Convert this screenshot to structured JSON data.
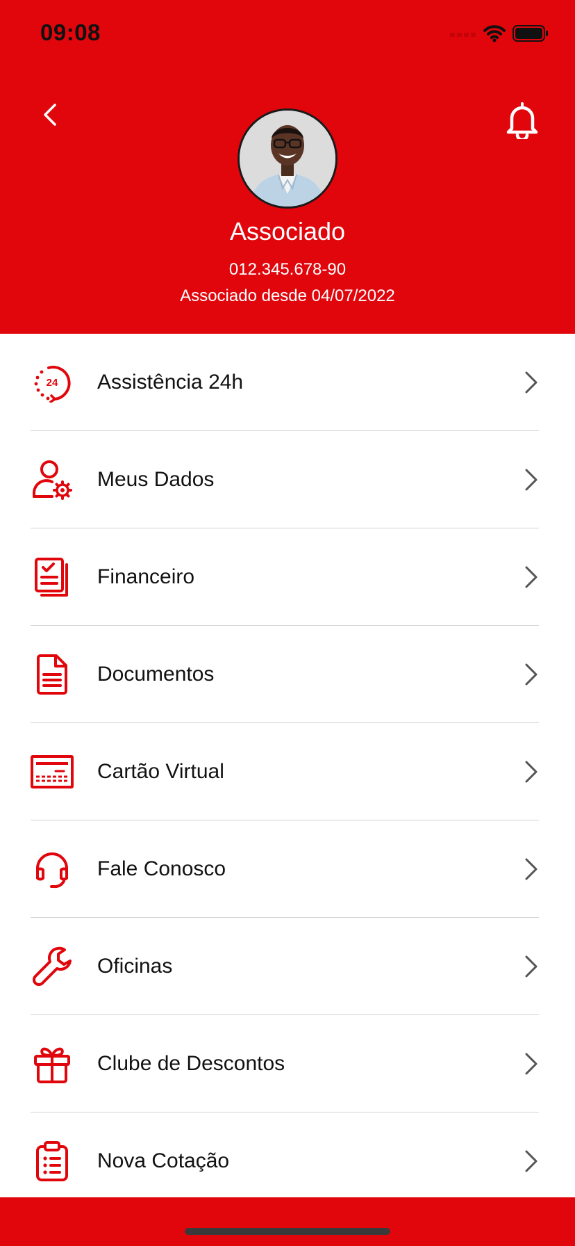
{
  "status_bar": {
    "time": "09:08",
    "icons": [
      "signal-icon",
      "wifi-icon",
      "battery-icon"
    ]
  },
  "header": {
    "back_icon": "chevron-left-icon",
    "notification_icon": "bell-icon",
    "avatar_icon": "avatar",
    "name": "Associado",
    "document": "012.345.678-90",
    "member_since": "Associado desde 04/07/2022"
  },
  "menu": {
    "items": [
      {
        "label": "Assistência 24h",
        "icon": "assistance-24h-icon"
      },
      {
        "label": "Meus Dados",
        "icon": "user-settings-icon"
      },
      {
        "label": "Financeiro",
        "icon": "financial-documents-icon"
      },
      {
        "label": "Documentos",
        "icon": "document-icon"
      },
      {
        "label": "Cartão Virtual",
        "icon": "virtual-card-icon"
      },
      {
        "label": "Fale Conosco",
        "icon": "headset-icon"
      },
      {
        "label": "Oficinas",
        "icon": "wrench-icon"
      },
      {
        "label": "Clube de Descontos",
        "icon": "gift-icon"
      },
      {
        "label": "Nova Cotação",
        "icon": "clipboard-list-icon"
      }
    ]
  },
  "colors": {
    "brand": "#e0060c",
    "text": "#111111",
    "divider": "#d4d4d4",
    "chevron": "#555555"
  }
}
